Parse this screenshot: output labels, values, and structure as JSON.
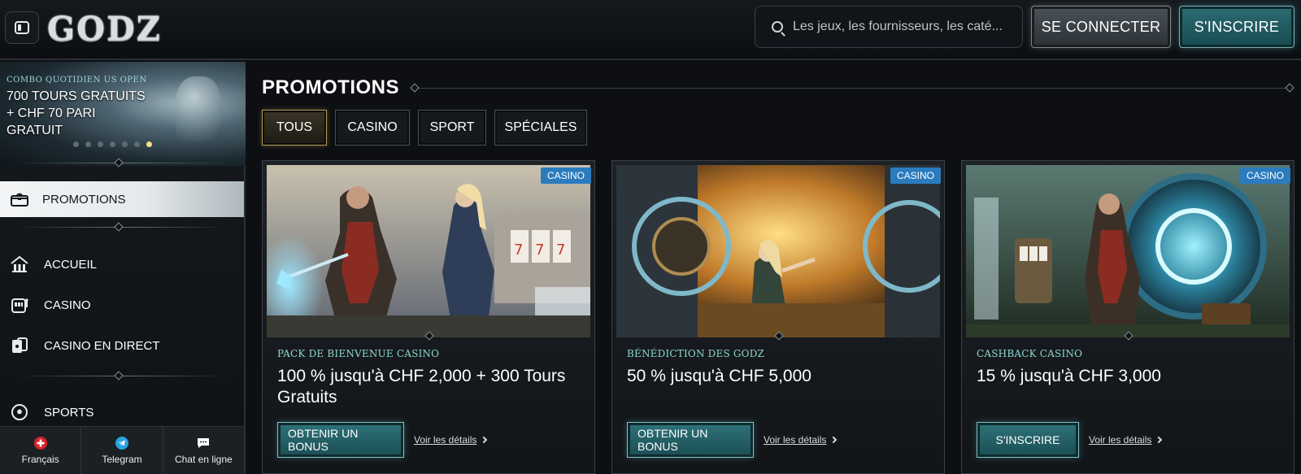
{
  "header": {
    "logo_text": "GODZ",
    "search_placeholder": "Les jeux, les fournisseurs, les caté...",
    "login_label": "SE CONNECTER",
    "signup_label": "S'INSCRIRE"
  },
  "sidebar": {
    "hero": {
      "eyebrow": "COMBO QUOTIDIEN US OPEN",
      "headline": "700 TOURS GRATUITS + CHF 70 PARI GRATUIT",
      "dot_count": 7,
      "active_dot": 7
    },
    "items": [
      {
        "label": "PROMOTIONS",
        "icon": "gift-chest-icon",
        "active": true
      },
      {
        "label": "ACCUEIL",
        "icon": "home-temple-icon"
      },
      {
        "label": "CASINO",
        "icon": "slot-machine-icon"
      },
      {
        "label": "CASINO EN DIRECT",
        "icon": "cards-icon"
      },
      {
        "label": "SPORTS",
        "icon": "soccer-ball-icon"
      }
    ],
    "bottom": [
      {
        "label": "Français",
        "icon": "swiss-flag-icon"
      },
      {
        "label": "Telegram",
        "icon": "telegram-icon"
      },
      {
        "label": "Chat en ligne",
        "icon": "chat-bubble-icon"
      }
    ]
  },
  "main": {
    "title": "PROMOTIONS",
    "tabs": [
      {
        "label": "TOUS",
        "active": true
      },
      {
        "label": "CASINO"
      },
      {
        "label": "SPORT"
      },
      {
        "label": "SPÉCIALES"
      }
    ],
    "cards": [
      {
        "badge": "CASINO",
        "subtitle": "PACK DE BIENVENUE CASINO",
        "headline": "100 % jusqu'à CHF 2,000 + 300 Tours Gratuits",
        "cta": "OBTENIR UN BONUS",
        "details": "Voir les détails"
      },
      {
        "badge": "CASINO",
        "subtitle": "BÉNÉDICTION DES GODZ",
        "headline": "50 % jusqu'à CHF 5,000",
        "cta": "OBTENIR UN BONUS",
        "details": "Voir les détails"
      },
      {
        "badge": "CASINO",
        "subtitle": "CASHBACK CASINO",
        "headline": "15 % jusqu'à CHF 3,000",
        "cta": "S'INSCRIRE",
        "details": "Voir les détails"
      }
    ]
  },
  "colors": {
    "accent_teal": "#2c6c73",
    "badge_blue": "#2b7cbf",
    "active_tab_gold": "#b79a52",
    "subtitle_teal": "#8fd8d0"
  }
}
